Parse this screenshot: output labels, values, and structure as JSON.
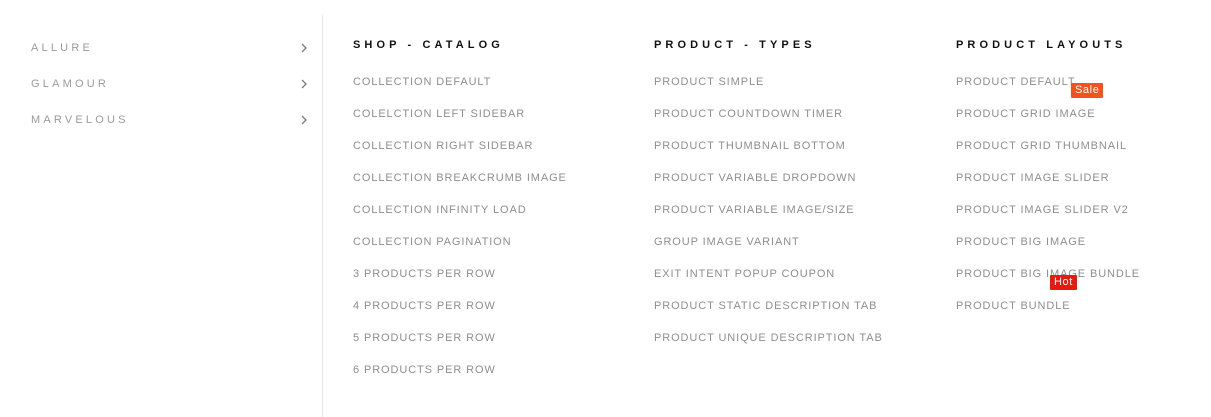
{
  "sidebar": {
    "items": [
      {
        "label": "ALLURE"
      },
      {
        "label": "GLAMOUR"
      },
      {
        "label": "MARVELOUS"
      }
    ]
  },
  "columns": [
    {
      "title": "SHOP - CATALOG",
      "items": [
        "COLLECTION DEFAULT",
        "COLELCTION LEFT SIDEBAR",
        "COLLECTION RIGHT SIDEBAR",
        "COLLECTION BREAKCRUMB IMAGE",
        "COLLECTION INFINITY LOAD",
        "COLLECTION PAGINATION",
        "3 PRODUCTS PER ROW",
        "4 PRODUCTS PER ROW",
        "5 PRODUCTS PER ROW",
        "6 PRODUCTS PER ROW"
      ]
    },
    {
      "title": "PRODUCT - TYPES",
      "items": [
        "PRODUCT SIMPLE",
        "PRODUCT COUNTDOWN TIMER",
        "PRODUCT THUMBNAIL BOTTOM",
        "PRODUCT VARIABLE DROPDOWN",
        "PRODUCT VARIABLE IMAGE/SIZE",
        "GROUP IMAGE VARIANT",
        "EXIT INTENT POPUP COUPON",
        "PRODUCT STATIC DESCRIPTION TAB",
        "PRODUCT UNIQUE DESCRIPTION TAB"
      ]
    },
    {
      "title": "PRODUCT LAYOUTS",
      "items": [
        "PRODUCT DEFAULT",
        "PRODUCT GRID IMAGE",
        "PRODUCT GRID THUMBNAIL",
        "PRODUCT IMAGE SLIDER",
        "PRODUCT IMAGE SLIDER V2",
        "PRODUCT BIG IMAGE",
        "PRODUCT BIG IMAGE BUNDLE",
        "PRODUCT BUNDLE"
      ]
    }
  ],
  "badges": {
    "sale": {
      "label": "Sale",
      "color": "#f4511e"
    },
    "hot": {
      "label": "Hot",
      "color": "#e8190f"
    }
  },
  "colors": {
    "text_muted": "#8e8e8e",
    "heading": "#111111",
    "divider": "#e6e6e6"
  },
  "icons": {
    "sidebar_arrow": "chevron-right-icon"
  }
}
